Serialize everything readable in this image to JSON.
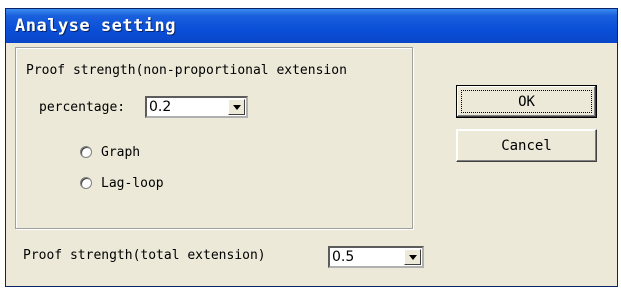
{
  "window": {
    "title": "Analyse setting"
  },
  "group": {
    "legend": "Proof strength(non-proportional extension",
    "percentage_label": "percentage:",
    "percentage_value": "0.2",
    "radios": [
      {
        "label": "Graph",
        "selected": false
      },
      {
        "label": "Lag-loop",
        "selected": false
      }
    ]
  },
  "total": {
    "label": "Proof strength(total extension)",
    "value": "0.5"
  },
  "buttons": {
    "ok": "OK",
    "cancel": "Cancel"
  },
  "icons": {
    "dropdown": "chevron-down-icon"
  }
}
